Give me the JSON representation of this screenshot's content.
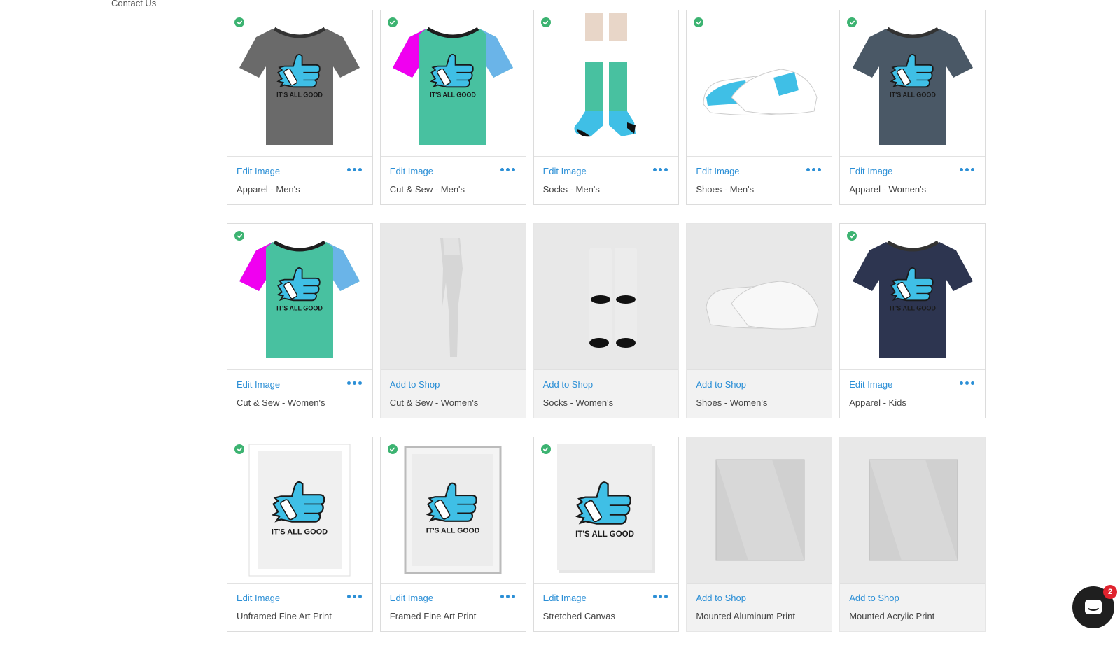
{
  "sidebar": {
    "contact_label": "Contact Us"
  },
  "colors": {
    "accent": "#2b8fd6",
    "check": "#3cb371",
    "badge": "#e0232e"
  },
  "products": [
    {
      "label": "Apparel - Men's",
      "action": "Edit Image",
      "enabled": true,
      "thumb": "tshirt",
      "shirt": "#6a6a6a"
    },
    {
      "label": "Cut & Sew - Men's",
      "action": "Edit Image",
      "enabled": true,
      "thumb": "cutsew"
    },
    {
      "label": "Socks - Men's",
      "action": "Edit Image",
      "enabled": true,
      "thumb": "socks-color"
    },
    {
      "label": "Shoes - Men's",
      "action": "Edit Image",
      "enabled": true,
      "thumb": "shoes-color"
    },
    {
      "label": "Apparel - Women's",
      "action": "Edit Image",
      "enabled": true,
      "thumb": "tshirt-w",
      "shirt": "#4a5866"
    },
    {
      "label": "Cut & Sew - Women's",
      "action": "Edit Image",
      "enabled": true,
      "thumb": "cutsew"
    },
    {
      "label": "Cut & Sew - Women's",
      "action": "Add to Shop",
      "enabled": false,
      "thumb": "leggings"
    },
    {
      "label": "Socks - Women's",
      "action": "Add to Shop",
      "enabled": false,
      "thumb": "socks-plain"
    },
    {
      "label": "Shoes - Women's",
      "action": "Add to Shop",
      "enabled": false,
      "thumb": "shoes-plain"
    },
    {
      "label": "Apparel - Kids",
      "action": "Edit Image",
      "enabled": true,
      "thumb": "tshirt",
      "shirt": "#2d3550"
    },
    {
      "label": "Unframed Fine Art Print",
      "action": "Edit Image",
      "enabled": true,
      "thumb": "print"
    },
    {
      "label": "Framed Fine Art Print",
      "action": "Edit Image",
      "enabled": true,
      "thumb": "framed"
    },
    {
      "label": "Stretched Canvas",
      "action": "Edit Image",
      "enabled": true,
      "thumb": "canvas"
    },
    {
      "label": "Mounted Aluminum Print",
      "action": "Add to Shop",
      "enabled": false,
      "thumb": "panel"
    },
    {
      "label": "Mounted Acrylic Print",
      "action": "Add to Shop",
      "enabled": false,
      "thumb": "panel"
    }
  ],
  "design_text": "IT'S ALL GOOD",
  "chat": {
    "badge_count": "2",
    "icon": "chat-bubble-icon"
  }
}
